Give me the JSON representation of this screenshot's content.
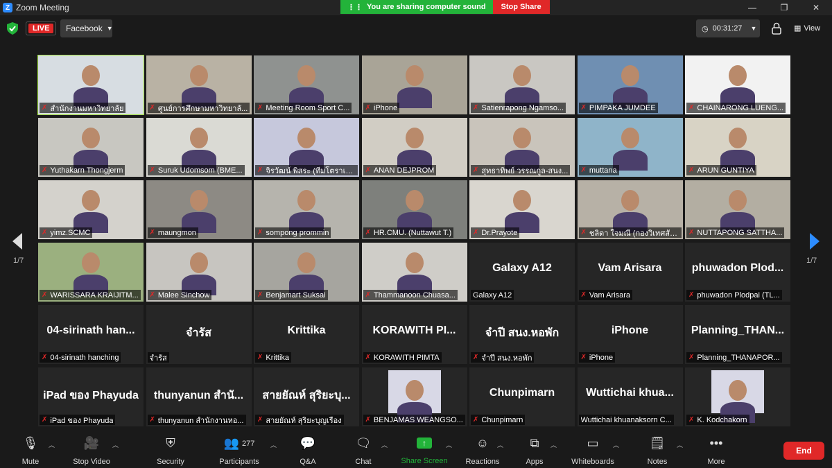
{
  "window": {
    "title": "Zoom Meeting"
  },
  "share": {
    "sound": "You are sharing computer sound",
    "stop": "Stop Share"
  },
  "topbar": {
    "live": "LIVE",
    "stream": "Facebook",
    "timer": "00:31:27",
    "view": "View"
  },
  "pager": {
    "left": "1/7",
    "right": "1/7"
  },
  "tiles": [
    {
      "name": "สำนักงานมหาวิทยาลัย",
      "bg": "#d7dde2",
      "video": true
    },
    {
      "name": "ศูนย์การศึกษามหาวิทยาลั...",
      "bg": "#b9b2a4",
      "video": true
    },
    {
      "name": "Meeting Room Sport C...",
      "bg": "#8f9290",
      "video": true
    },
    {
      "name": "iPhone",
      "bg": "#a9a497",
      "video": true
    },
    {
      "name": "Satienrapong Ngamso...",
      "bg": "#c9c7c2",
      "video": true
    },
    {
      "name": "PIMPAKA JUMDEE",
      "bg": "#6f8fb2",
      "video": true
    },
    {
      "name": "CHAINARONG LUENG...",
      "bg": "#f2f2f2",
      "video": true
    },
    {
      "name": "Yuthakarn Thongjerm",
      "bg": "#c8c7c1",
      "video": true
    },
    {
      "name": "Suruk Udomsom (BME...",
      "bg": "#dadad4",
      "video": true
    },
    {
      "name": "จิรวัฒน์ พิสระ (ทีมโตราเอม...",
      "bg": "#c6c8dc",
      "video": true
    },
    {
      "name": "ANAN DEJPROM",
      "bg": "#d1cdc4",
      "video": true
    },
    {
      "name": "สุทธาทิพย์ วรรณกูล-สนง...",
      "bg": "#c9c4bb",
      "video": true
    },
    {
      "name": "muttana",
      "bg": "#8fb4c9",
      "video": true
    },
    {
      "name": "ARUN GUNTIYA",
      "bg": "#d8d3c5",
      "video": true
    },
    {
      "name": "yimz.SCMC",
      "bg": "#d4d2cc",
      "video": true
    },
    {
      "name": "maungmon",
      "bg": "#8d8a84",
      "video": true
    },
    {
      "name": "sompong prommin",
      "bg": "#b6b4ad",
      "video": true
    },
    {
      "name": "HR.CMU. (Nuttawut T.)",
      "bg": "#7e807c",
      "video": true
    },
    {
      "name": "Dr.Prayote",
      "bg": "#d9d6cf",
      "video": true
    },
    {
      "name": "ชลิดา ใจมณี (กองวิเทศสัม...",
      "bg": "#b7b1a6",
      "video": true
    },
    {
      "name": "NUTTAPONG SATTHA...",
      "bg": "#b3aea2",
      "video": true
    },
    {
      "name": "WARISSARA KRAIJITM...",
      "bg": "#9bb07f",
      "video": true
    },
    {
      "name": "Malee Sinchow",
      "bg": "#c7c5c0",
      "video": true
    },
    {
      "name": "Benjamart Suksai",
      "bg": "#a6a59f",
      "video": true
    },
    {
      "name": "Thammanoon Chuasa...",
      "bg": "#cfcdc8",
      "video": true
    },
    {
      "name": "Galaxy A12",
      "big": "Galaxy A12",
      "video": false,
      "muted": false
    },
    {
      "name": "Vam Arisara",
      "big": "Vam Arisara",
      "video": false
    },
    {
      "name": "phuwadon Plodpai (TL...",
      "big": "phuwadon Plod...",
      "video": false
    },
    {
      "name": "04-sirinath hanching",
      "big": "04-sirinath han...",
      "video": false
    },
    {
      "name": "จำรัส",
      "big": "จำรัส",
      "video": false,
      "muted": false
    },
    {
      "name": "Krittika",
      "big": "Krittika",
      "video": false
    },
    {
      "name": "KORAWITH PIMTA",
      "big": "KORAWITH PI...",
      "video": false
    },
    {
      "name": "จำปี สนง.หอพัก",
      "big": "จำปี สนง.หอพัก",
      "video": false
    },
    {
      "name": "iPhone",
      "big": "iPhone",
      "video": false
    },
    {
      "name": "Planning_THANAPOR...",
      "big": "Planning_THAN...",
      "video": false
    },
    {
      "name": "iPad ของ Phayuda",
      "big": "iPad ของ Phayuda",
      "video": false
    },
    {
      "name": "thunyanun สำนักงานหอ...",
      "big": "thunyanun สำนั...",
      "video": false
    },
    {
      "name": "สายยัณห์ สุริยะบุญเรือง",
      "big": "สายยัณห์ สุริยะบุ...",
      "video": false
    },
    {
      "name": "BENJAMAS WEANGSO...",
      "bg": "#262626",
      "video": true,
      "avatar": true
    },
    {
      "name": "Chunpimarn",
      "big": "Chunpimarn",
      "video": false
    },
    {
      "name": "Wuttichai khuanaksorn C...",
      "big": "Wuttichai khua...",
      "video": false,
      "muted": false
    },
    {
      "name": "K. Kodchakorn",
      "bg": "#262626",
      "video": true,
      "avatar": true
    }
  ],
  "toolbar": {
    "mute": "Mute",
    "video": "Stop Video",
    "security": "Security",
    "participants": "Participants",
    "participants_count": "277",
    "qa": "Q&A",
    "chat": "Chat",
    "share": "Share Screen",
    "reactions": "Reactions",
    "apps": "Apps",
    "whiteboards": "Whiteboards",
    "notes": "Notes",
    "more": "More",
    "end": "End"
  },
  "colors": {
    "share_green": "#23b33a",
    "alert_red": "#e02828",
    "active_speaker": "#9ddd3b",
    "zoom_blue": "#2d8cff"
  }
}
